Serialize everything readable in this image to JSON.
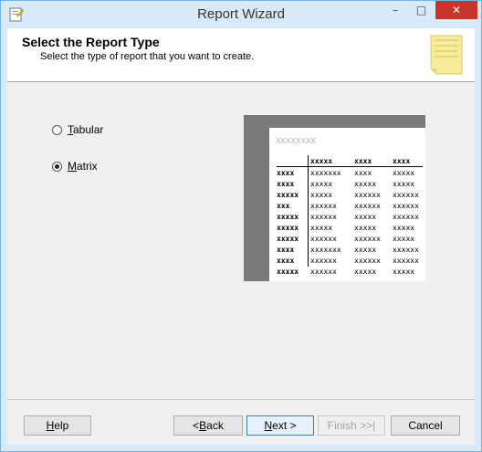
{
  "window": {
    "title": "Report Wizard",
    "controls": {
      "minimize": "–",
      "maximize": "□",
      "close": "✕"
    }
  },
  "header": {
    "title": "Select the Report Type",
    "description": "Select the type of report that you want to create."
  },
  "report_types": [
    {
      "label": "Tabular",
      "accel": "T",
      "rest": "abular",
      "selected": false
    },
    {
      "label": "Matrix",
      "accel": "M",
      "rest": "atrix",
      "selected": true
    }
  ],
  "preview": {
    "title": "xxxxxxxx",
    "header_row": [
      "",
      "xxxxx",
      "xxxx",
      "xxxx"
    ],
    "rows": [
      [
        "xxxx",
        "xxxxxxx",
        "xxxx",
        "xxxxx"
      ],
      [
        "xxxx",
        "xxxxx",
        "xxxxx",
        "xxxxx"
      ],
      [
        "xxxxx",
        "xxxxx",
        "xxxxxx",
        "xxxxxx"
      ],
      [
        "xxx",
        "xxxxxx",
        "xxxxxx",
        "xxxxxx"
      ],
      [
        "xxxxx",
        "xxxxxx",
        "xxxxx",
        "xxxxxx"
      ],
      [
        "xxxxx",
        "xxxxx",
        "xxxxx",
        "xxxxx"
      ],
      [
        "xxxxx",
        "xxxxxx",
        "xxxxxx",
        "xxxxx"
      ],
      [
        "xxxx",
        "xxxxxxx",
        "xxxxx",
        "xxxxxx"
      ],
      [
        "xxxx",
        "xxxxxx",
        "xxxxxx",
        "xxxxxx"
      ],
      [
        "xxxxx",
        "xxxxxx",
        "xxxxx",
        "xxxxx"
      ]
    ]
  },
  "buttons": {
    "help": {
      "accel": "H",
      "rest": "elp"
    },
    "back": {
      "pre": "< ",
      "accel": "B",
      "rest": "ack"
    },
    "next": {
      "accel": "N",
      "rest": "ext >"
    },
    "finish": {
      "label": "Finish >>|"
    },
    "cancel": {
      "label": "Cancel"
    }
  },
  "colors": {
    "title_bar": "#d8eaf7",
    "close_button": "#c7352d",
    "preview_frame": "#7a7a7a",
    "default_button_border": "#3c7fb1"
  }
}
